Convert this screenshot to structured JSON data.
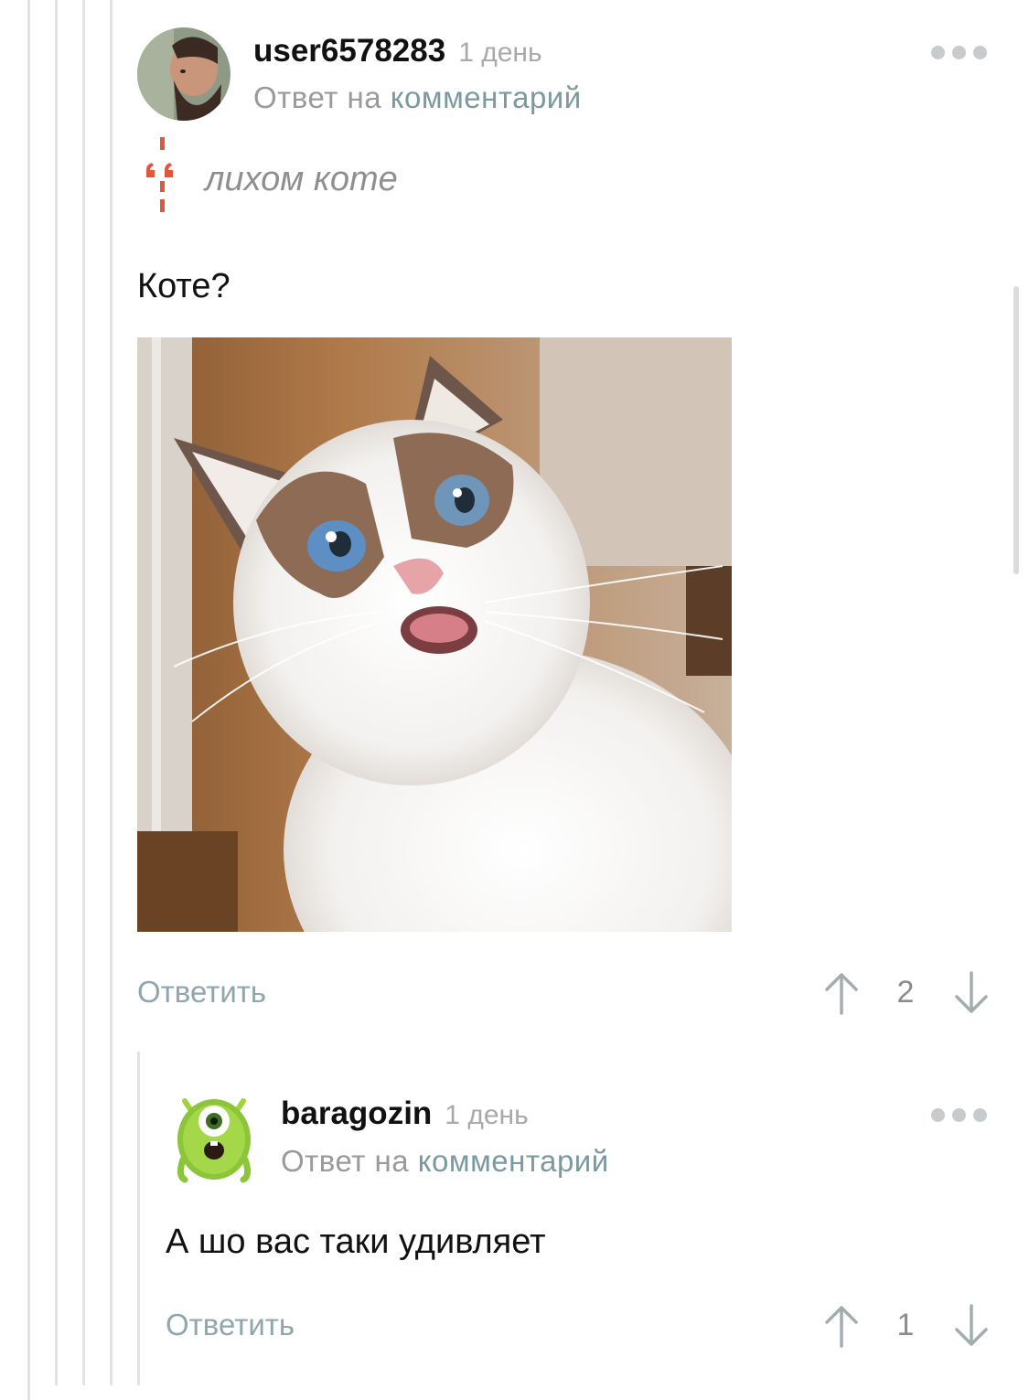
{
  "comment1": {
    "username": "user6578283",
    "time": "1 день",
    "reply_prefix": "Ответ на",
    "reply_link": "комментарий",
    "quote": "лихом коте",
    "text": "Коте?",
    "reply_button": "Ответить",
    "rating": "2"
  },
  "comment2": {
    "username": "baragozin",
    "time": "1 день",
    "reply_prefix": "Ответ на",
    "reply_link": "комментарий",
    "text": "А шо вас таки удивляет",
    "reply_button": "Ответить",
    "rating": "1"
  },
  "colors": {
    "accent_link": "#7a9aa0",
    "quote_mark": "#e2573b",
    "thread_line": "#e3e3e3"
  },
  "icons": [
    "more-dots-icon",
    "quote-icon",
    "upvote-arrow-icon",
    "downvote-arrow-icon"
  ]
}
